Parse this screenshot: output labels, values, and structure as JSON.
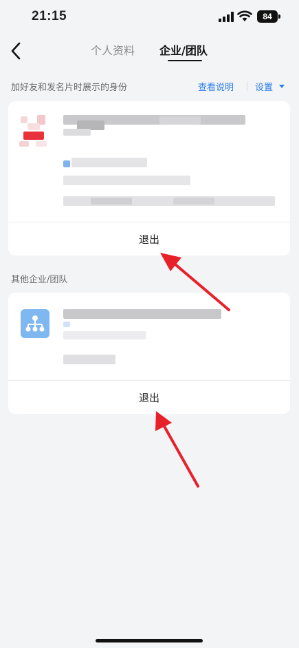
{
  "status_bar": {
    "time": "21:15",
    "battery": "84"
  },
  "nav": {
    "tabs": [
      {
        "label": "个人资料",
        "active": false
      },
      {
        "label": "企业/团队",
        "active": true
      }
    ]
  },
  "identity_section": {
    "label": "加好友和发名片时展示的身份",
    "help_link": "查看说明",
    "settings_link": "设置"
  },
  "current_enterprise": {
    "exit_label": "退出"
  },
  "other_section": {
    "label": "其他企业/团队"
  },
  "other_enterprise": {
    "exit_label": "退出"
  },
  "colors": {
    "accent": "#2b7de9",
    "annotation_arrow": "#e8202a"
  },
  "icons": [
    "chevron-left-icon",
    "signal-icon",
    "wifi-icon",
    "battery-icon",
    "caret-down-icon",
    "org-chart-icon"
  ]
}
